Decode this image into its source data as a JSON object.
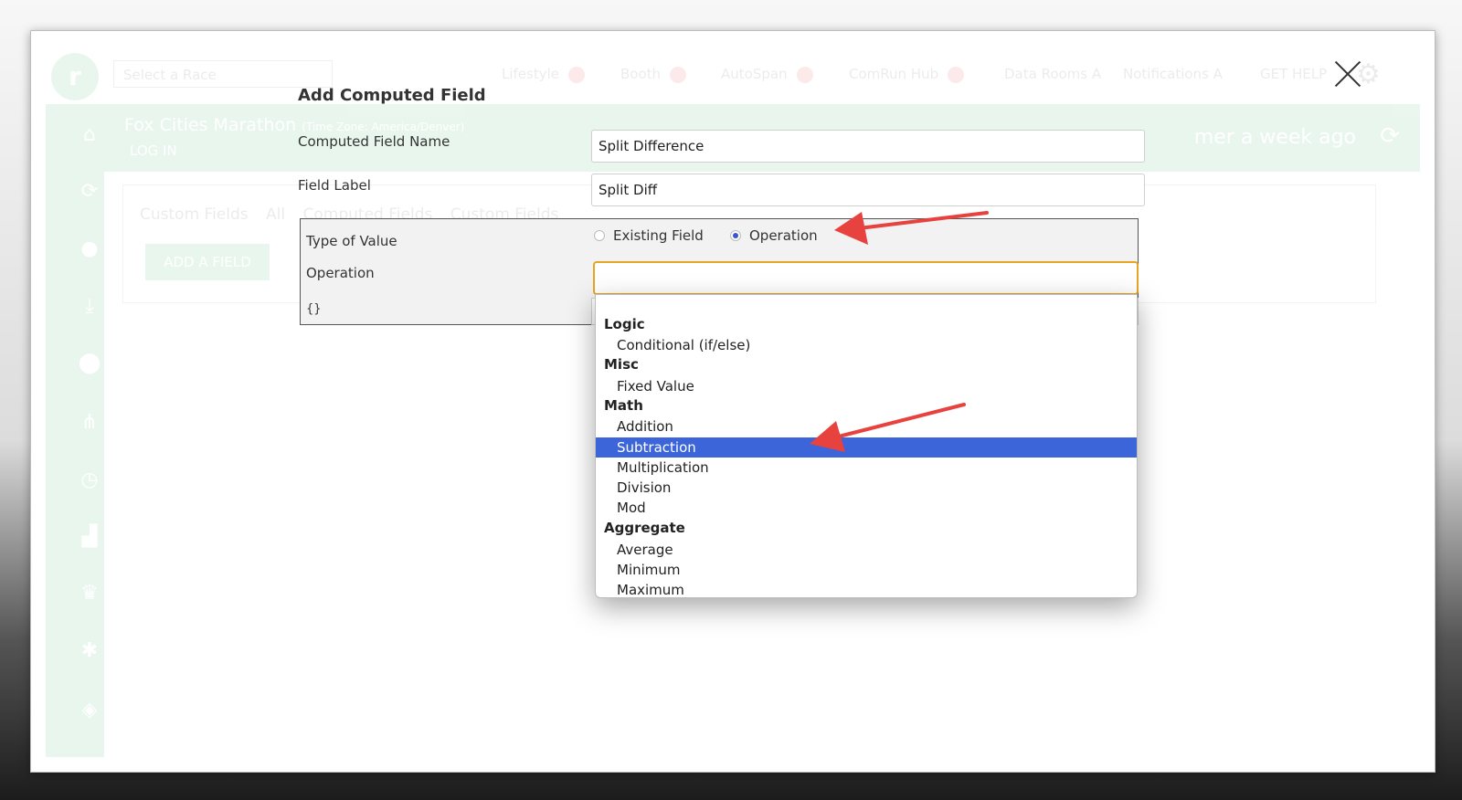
{
  "background": {
    "logo_letter": "r",
    "race_select": "Select a Race",
    "tabs": [
      {
        "label": "Lifestyle"
      },
      {
        "label": "Booth"
      },
      {
        "label": "AutoSpan"
      },
      {
        "label": "ComRun Hub"
      },
      {
        "label": "Data Rooms A"
      },
      {
        "label": "Notifications A"
      },
      {
        "label": "GET HELP"
      }
    ],
    "banner": {
      "title": "Fox Cities Marathon",
      "timezone": "(Time Zone: America/Denver)",
      "login": "LOG IN",
      "updated": "mer a week ago"
    },
    "card": {
      "tabs": [
        "Custom Fields",
        "All",
        "Computed Fields",
        "Custom Fields"
      ],
      "add_button": "ADD A FIELD"
    }
  },
  "modal": {
    "title": "Add Computed Field",
    "computed_field_name_label": "Computed Field Name",
    "computed_field_name_value": "Split Difference",
    "field_label_label": "Field Label",
    "field_label_value": "Split Diff",
    "type_of_value_label": "Type of Value",
    "radio_existing": "Existing Field",
    "radio_operation": "Operation",
    "selected_type": "Operation",
    "operation_label": "Operation",
    "operation_value": "",
    "json_preview": "{}"
  },
  "dropdown": {
    "groups": [
      {
        "label": "Logic",
        "options": [
          "Conditional (if/else)"
        ]
      },
      {
        "label": "Misc",
        "options": [
          "Fixed Value"
        ]
      },
      {
        "label": "Math",
        "options": [
          "Addition",
          "Subtraction",
          "Multiplication",
          "Division",
          "Mod"
        ]
      },
      {
        "label": "Aggregate",
        "options": [
          "Average",
          "Minimum",
          "Maximum"
        ]
      }
    ],
    "highlighted": "Subtraction"
  },
  "colors": {
    "accent_green": "#1aa551",
    "highlight_blue": "#3b65d9",
    "focus_border": "#e8a523",
    "annotation_arrow": "#e8423f"
  }
}
